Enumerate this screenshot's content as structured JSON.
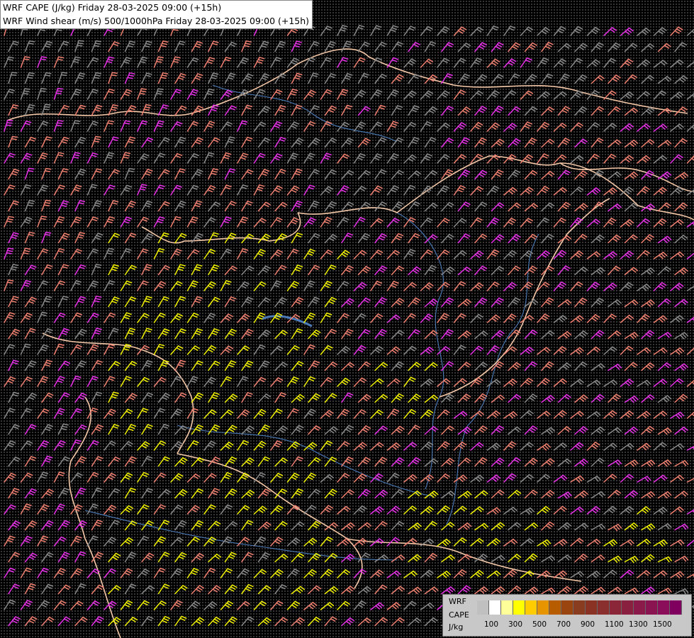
{
  "header": {
    "line1": "WRF CAPE (J/kg) Friday 28-03-2025 09:00 (+15h)",
    "line2": "WRF Wind shear (m/s) 500/1000hPa Friday 28-03-2025 09:00 (+15h)"
  },
  "legend": {
    "model": "WRF",
    "variable": "CAPE",
    "unit": "J/kg",
    "colors": [
      "#c0c0c0",
      "#ffffff",
      "#ffff99",
      "#ffff00",
      "#ffcc00",
      "#e69500",
      "#b85c00",
      "#9a4510",
      "#8a3c20",
      "#8a3324",
      "#8a2e2e",
      "#8a2638",
      "#8a2040",
      "#8a1a4a",
      "#8a1452",
      "#8a0e5a",
      "#800060"
    ],
    "ticks": [
      "100",
      "300",
      "500",
      "700",
      "900",
      "1100",
      "1300",
      "1500"
    ]
  },
  "map": {
    "background": "#000000",
    "palette": {
      "gray": "#8a8a8a",
      "salmon": "#f08070",
      "magenta": "#e830e8",
      "yellow": "#f0f000",
      "border": "#f5c8a8",
      "water": "#4a7ab8"
    },
    "features": [
      "wind-barbs",
      "country-borders",
      "rivers-lakes",
      "cape-shading"
    ]
  }
}
